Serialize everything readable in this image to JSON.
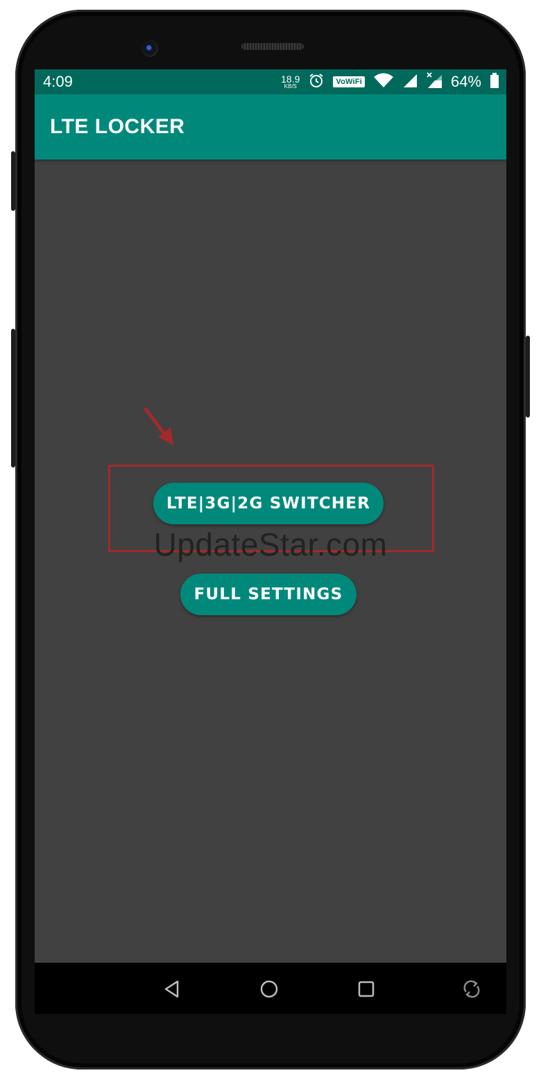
{
  "status_bar": {
    "time": "4:09",
    "speed_value": "18.9",
    "speed_unit": "KB/S",
    "vowifi_label": "VoWiFi",
    "battery_percent": "64%"
  },
  "app_bar": {
    "title": "LTE LOCKER"
  },
  "main": {
    "switcher_button": "LTE|3G|2G SWITCHER",
    "full_settings_button": "FULL SETTINGS"
  },
  "watermark": "UpdateStar.com",
  "colors": {
    "status_bar": "#00695c",
    "app_bar": "#00897b",
    "background": "#414141",
    "highlight": "#a32a2a"
  },
  "icons": {
    "status": [
      "alarm-icon",
      "wifi-icon",
      "signal-icon",
      "signal-x-icon",
      "battery-icon"
    ],
    "nav": [
      "back-icon",
      "home-icon",
      "recents-icon",
      "rotate-icon"
    ]
  }
}
